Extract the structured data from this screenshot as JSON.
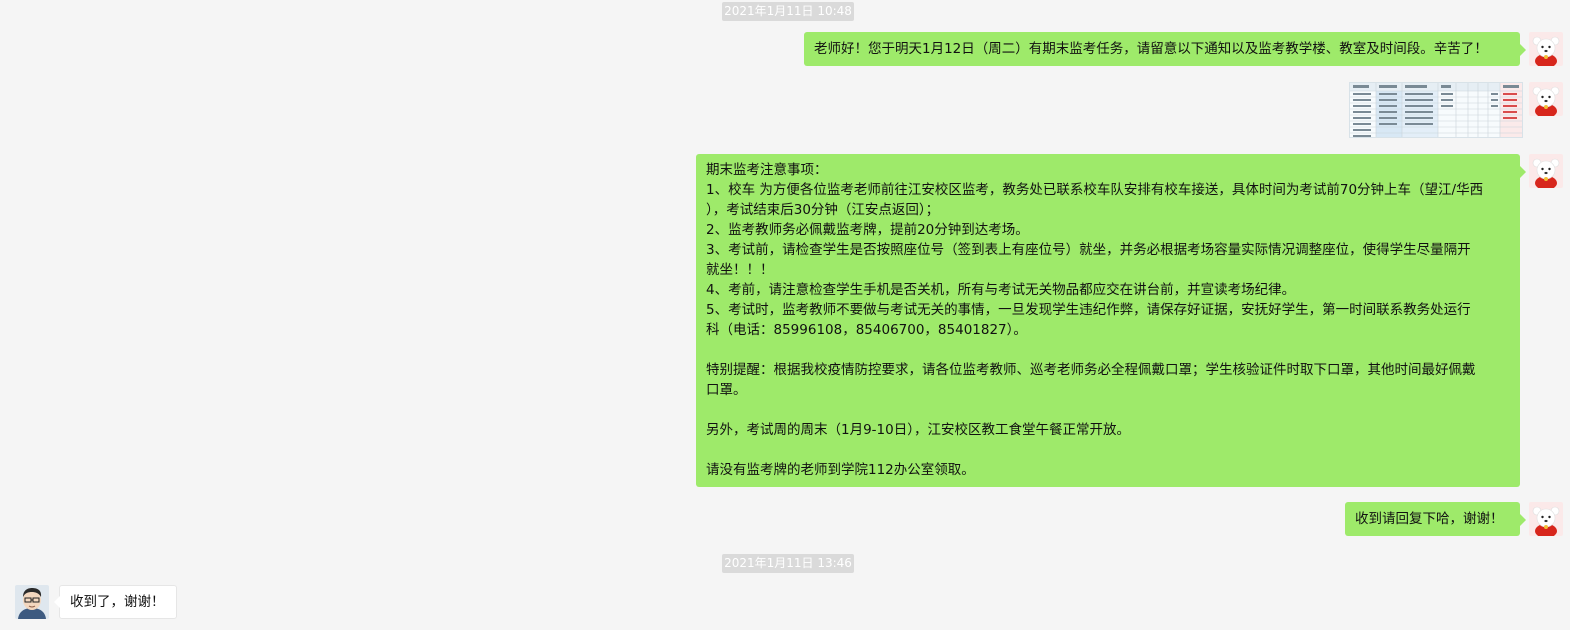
{
  "timestamps": [
    "2021年1月11日 10:48",
    "2021年1月11日 13:46"
  ],
  "messages": {
    "m1": "老师好！您于明天1月12日（周二）有期末监考任务，请留意以下通知以及监考教学楼、教室及时间段。辛苦了！",
    "notice": {
      "lines": [
        "期末监考注意事项：",
        "1、校车 为方便各位监考老师前往江安校区监考，教务处已联系校车队安排有校车接送，具体时间为考试前70分钟上车（望江/华西",
        "），考试结束后30分钟（江安点返回）；",
        "2、监考教师务必佩戴监考牌，提前20分钟到达考场。",
        "3、考试前，请检查学生是否按照座位号（签到表上有座位号）就坐，并务必根据考场容量实际情况调整座位，使得学生尽量隔开",
        "就坐！！！",
        "4、考前，请注意检查学生手机是否关机，所有与考试无关物品都应交在讲台前，并宣读考场纪律。",
        "5、考试时，监考教师不要做与考试无关的事情，一旦发现学生违纪作弊，请保存好证据，安抚好学生，第一时间联系教务处运行",
        "科（电话：85996108，85406700，85401827）。",
        "",
        "特别提醒：根据我校疫情防控要求，请各位监考教师、巡考老师务必全程佩戴口罩；学生核验证件时取下口罩，其他时间最好佩戴",
        "口罩。",
        "",
        "另外，考试周的周末（1月9-10日），江安校区教工食堂午餐正常开放。",
        "",
        "请没有监考牌的老师到学院112办公室领取。"
      ]
    },
    "m3": "收到请回复下哈，谢谢！",
    "reply": "收到了，谢谢！"
  },
  "icons": {
    "sender_avatar": "bear-avatar-icon",
    "receiver_avatar": "man-glasses-avatar-icon",
    "image": "spreadsheet-thumbnail"
  },
  "colors": {
    "outgoing_bubble": "#9eea6a",
    "incoming_bubble": "#ffffff",
    "background": "#f5f5f5",
    "timestamp_bg": "#dadada"
  }
}
